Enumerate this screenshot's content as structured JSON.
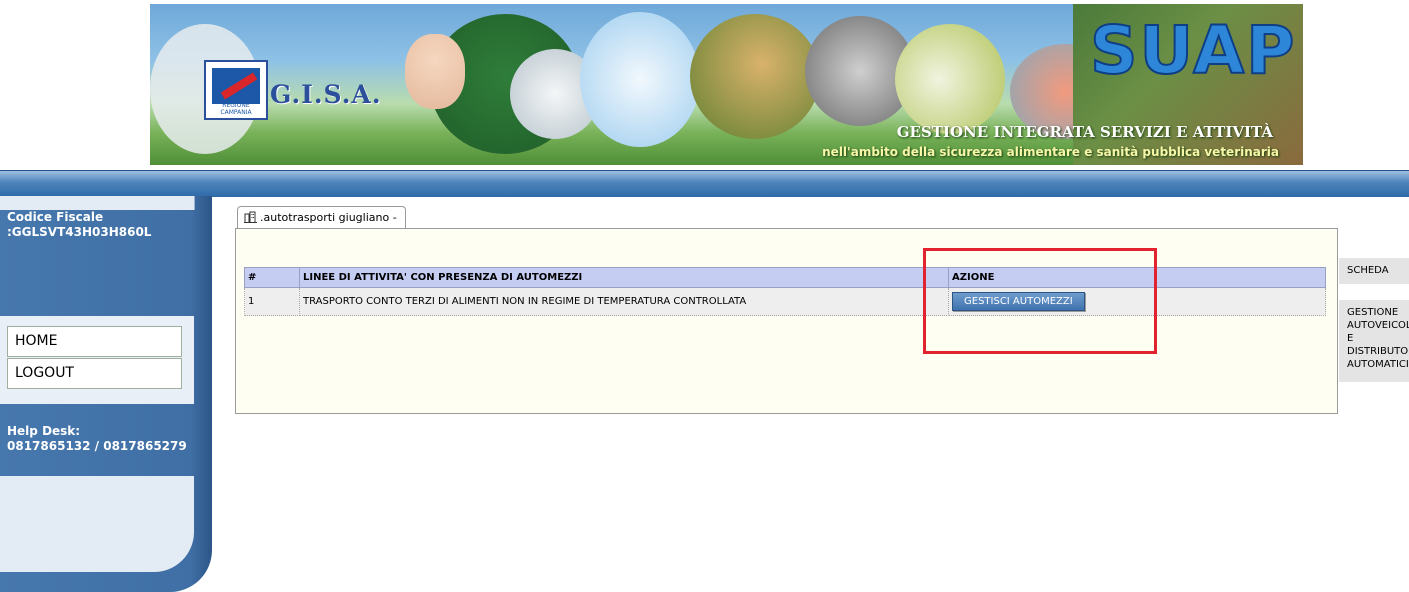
{
  "banner": {
    "logo_text": "G.I.S.A.",
    "logo_region": "REGIONE CAMPANIA",
    "brand": "SUAP",
    "tagline": "GESTIONE INTEGRATA SERVIZI E ATTIVITÀ",
    "subtagline": "nell'ambito della sicurezza alimentare e sanità pubblica veterinaria"
  },
  "sidebar": {
    "codice_fiscale_label": "Codice Fiscale",
    "codice_fiscale_value": ":GGLSVT43H03H860L",
    "menu": [
      {
        "label": "HOME"
      },
      {
        "label": "LOGOUT"
      }
    ],
    "help_desk_label": "Help Desk:",
    "help_desk_numbers": "0817865132 / 0817865279"
  },
  "main": {
    "tab_label": ".autotrasporti giugliano -",
    "table": {
      "headers": [
        "#",
        "LINEE DI ATTIVITA' CON PRESENZA DI AUTOMEZZI",
        "AZIONE"
      ],
      "rows": [
        {
          "index": "1",
          "description": "TRASPORTO CONTO TERZI DI ALIMENTI NON IN REGIME DI TEMPERATURA CONTROLLATA",
          "action_label": "GESTISCI AUTOMEZZI"
        }
      ]
    }
  },
  "right_tabs": {
    "scheda": "SCHEDA",
    "gestione": "GESTIONE AUTOVEICOLI E DISTRIBUTORI AUTOMATICI"
  },
  "colors": {
    "sidebar": "#4677ad",
    "table_header": "#c6cdf2",
    "panel_bg": "#fefef2",
    "highlight": "#e0232f",
    "button": "#4f80b8"
  }
}
